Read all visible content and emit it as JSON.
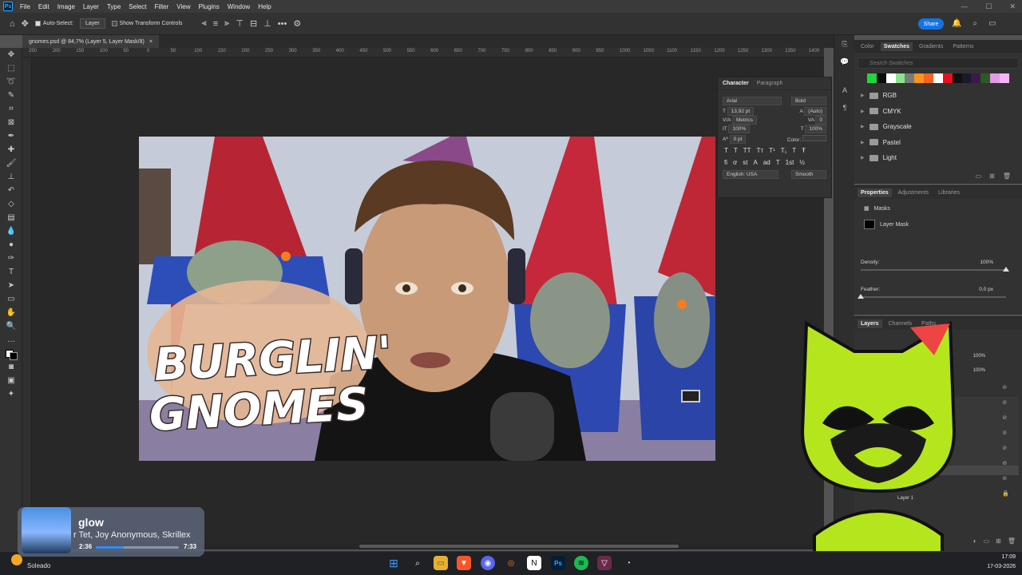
{
  "menubar": {
    "items": [
      "File",
      "Edit",
      "Image",
      "Layer",
      "Type",
      "Select",
      "Filter",
      "View",
      "Plugins",
      "Window",
      "Help"
    ]
  },
  "options": {
    "auto_select_label": "Auto-Select:",
    "layer_select": "Layer",
    "show_transform_label": "Show Transform Controls",
    "share_label": "Share"
  },
  "document": {
    "tab_title": "gnomes.psd @ 84,7% (Layer 5, Layer Mask/8)",
    "title_line1": "BURGLIN'",
    "title_line2": "GNOMES"
  },
  "ruler": {
    "ticks": [
      "250",
      "200",
      "150",
      "100",
      "50",
      "0",
      "50",
      "100",
      "150",
      "200",
      "250",
      "300",
      "350",
      "400",
      "450",
      "500",
      "550",
      "600",
      "650",
      "700",
      "750",
      "800",
      "850",
      "900",
      "950",
      "1000",
      "1050",
      "1100",
      "1150",
      "1200",
      "1250",
      "1300",
      "1350",
      "1400"
    ]
  },
  "character": {
    "tab_character": "Character",
    "tab_paragraph": "Paragraph",
    "font": "Arial",
    "style": "Bold",
    "size": "13,92 pt",
    "leading": "(Auto)",
    "kerning": "Metrics",
    "tracking": "0",
    "vscale": "100%",
    "hscale": "100%",
    "baseline": "0 pt",
    "color_label": "Color:",
    "language": "English: USA",
    "aa": "Smooth",
    "style_buttons": [
      "T",
      "T",
      "TT",
      "Tт",
      "T¹",
      "T₁",
      "T",
      "Ŧ"
    ],
    "ot_buttons": [
      "fi",
      "ơ",
      "st",
      "A",
      "ad",
      "T",
      "1st",
      "½"
    ]
  },
  "swatches": {
    "tabs": [
      "Color",
      "Swatches",
      "Gradients",
      "Patterns"
    ],
    "search_placeholder": "Search Swatches",
    "recent_colors": [
      "#1fd63b",
      "#0b0b0b",
      "#ffffff",
      "#8be38b",
      "#7a7a7a",
      "#f7941d",
      "#f26522",
      "#ffffff",
      "#e8101f",
      "#101010",
      "#1a1a2a",
      "#3a1a4a",
      "#2b5a22",
      "#e39be3",
      "#f7b5f5"
    ],
    "folders": [
      "RGB",
      "CMYK",
      "Grayscale",
      "Pastel",
      "Light"
    ]
  },
  "properties": {
    "tabs": [
      "Properties",
      "Adjustments",
      "Libraries"
    ],
    "masks_label": "Masks",
    "layer_mask_label": "Layer Mask",
    "density_label": "Density:",
    "density_value": "100%",
    "feather_label": "Feather:",
    "feather_value": "0,0 px",
    "density_level": 1.0,
    "feather_level": 0.0
  },
  "layers": {
    "tabs": [
      "Layers",
      "Channels",
      "Paths"
    ],
    "opacity": "100%",
    "fill": "100%",
    "visible_layer_name": "Layer 1"
  },
  "music": {
    "title": "glow",
    "artist": "r Tet, Joy Anonymous, Skrillex",
    "elapsed": "2:36",
    "duration": "7:33",
    "progress": 0.34
  },
  "weather": {
    "label": "Soleado"
  },
  "clock": {
    "time": "17:09",
    "date": "17-03-2026"
  },
  "colors": {
    "accent": "#1473e6",
    "gnome_hat": "#c0283a",
    "mascot": "#b5e61d"
  }
}
